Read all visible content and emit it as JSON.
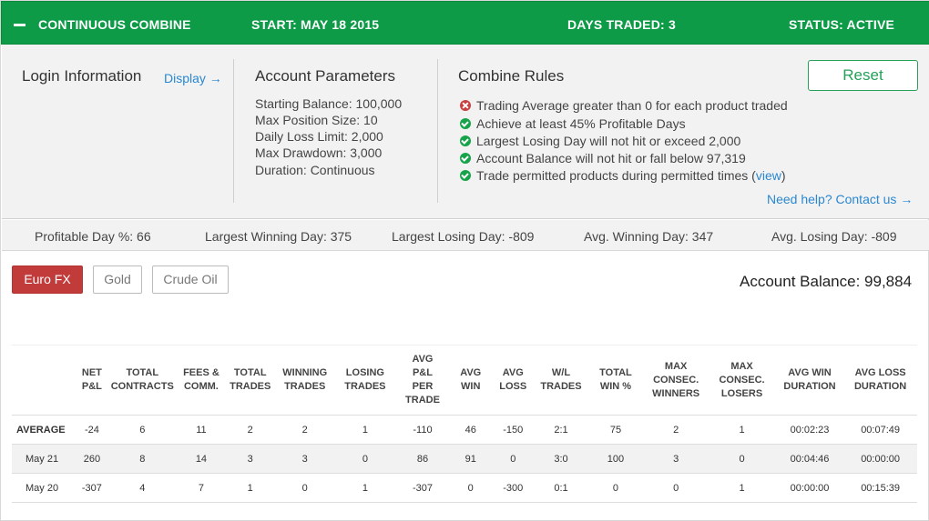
{
  "header": {
    "title": "CONTINUOUS COMBINE",
    "start": "START: MAY 18 2015",
    "days_traded": "DAYS TRADED: 3",
    "status": "STATUS: ACTIVE",
    "background_color": "#0d9b47"
  },
  "login": {
    "title": "Login Information",
    "display_link": "Display →"
  },
  "account_parameters": {
    "title": "Account Parameters",
    "items": [
      "Starting Balance: 100,000",
      "Max Position Size: 10",
      "Daily Loss Limit: 2,000",
      "Max Drawdown: 3,000",
      "Duration: Continuous"
    ]
  },
  "combine_rules": {
    "title": "Combine Rules",
    "reset_label": "Reset",
    "rules": [
      {
        "text": "Trading Average greater than 0 for each product traded",
        "status": "failed",
        "icon": "x-circle-icon"
      },
      {
        "text": "Achieve at least 45% Profitable Days",
        "status": "passed",
        "icon": "check-circle-icon"
      },
      {
        "text": "Largest Losing Day will not hit or exceed 2,000",
        "status": "passed",
        "icon": "check-circle-icon"
      },
      {
        "text": "Account Balance will not hit or fall below 97,319",
        "status": "passed",
        "icon": "check-circle-icon"
      },
      {
        "text": "Trade permitted products during permitted times (",
        "status": "passed",
        "icon": "check-circle-icon",
        "link": "view",
        "suffix": ")"
      }
    ],
    "help_link": "Need help? Contact us →",
    "pass_color": "#16a34a",
    "fail_color": "#c94040"
  },
  "stats": {
    "profitable_day": "Profitable Day %: 66",
    "largest_winning": "Largest Winning Day: 375",
    "largest_losing": "Largest Losing Day: -809",
    "avg_winning": "Avg. Winning Day: 347",
    "avg_losing": "Avg. Losing Day: -809"
  },
  "products": {
    "tabs": [
      {
        "label": "Euro FX",
        "active": true
      },
      {
        "label": "Gold",
        "active": false
      },
      {
        "label": "Crude Oil",
        "active": false
      }
    ],
    "account_balance": "Account Balance: 99,884",
    "active_color": "#c23b3b"
  },
  "table": {
    "headers": [
      [
        ""
      ],
      [
        "NET",
        "P&L"
      ],
      [
        "TOTAL",
        "CONTRACTS"
      ],
      [
        "FEES &",
        "COMM."
      ],
      [
        "TOTAL",
        "TRADES"
      ],
      [
        "WINNING",
        "TRADES"
      ],
      [
        "LOSING",
        "TRADES"
      ],
      [
        "AVG",
        "P&L",
        "PER",
        "TRADE"
      ],
      [
        "AVG",
        "WIN"
      ],
      [
        "AVG",
        "LOSS"
      ],
      [
        "W/L",
        "TRADES"
      ],
      [
        "TOTAL",
        "WIN %"
      ],
      [
        "MAX",
        "CONSEC.",
        "WINNERS"
      ],
      [
        "MAX",
        "CONSEC.",
        "LOSERS"
      ],
      [
        "AVG WIN",
        "DURATION"
      ],
      [
        "AVG LOSS",
        "DURATION"
      ]
    ],
    "rows": [
      {
        "kind": "avg",
        "cells": [
          "AVERAGE",
          "-24",
          "6",
          "11",
          "2",
          "2",
          "1",
          "-110",
          "46",
          "-150",
          "2:1",
          "75",
          "2",
          "1",
          "00:02:23",
          "00:07:49"
        ]
      },
      {
        "kind": "sub",
        "cells": [
          "May 21",
          "260",
          "8",
          "14",
          "3",
          "3",
          "0",
          "86",
          "91",
          "0",
          "3:0",
          "100",
          "3",
          "0",
          "00:04:46",
          "00:00:00"
        ]
      },
      {
        "kind": "sub",
        "cells": [
          "May 20",
          "-307",
          "4",
          "7",
          "1",
          "0",
          "1",
          "-307",
          "0",
          "-300",
          "0:1",
          "0",
          "0",
          "1",
          "00:00:00",
          "00:15:39"
        ]
      }
    ]
  }
}
